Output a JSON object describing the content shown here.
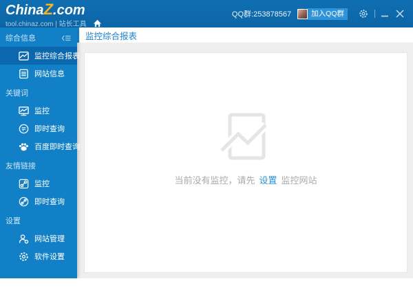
{
  "titlebar": {
    "logo": {
      "part1": "China",
      "part2": "Z",
      "part3": ".com"
    },
    "subtitle": "tool.chinaz.com | 站长工具",
    "qq_group_label": "QQ群:253878567",
    "join_qq_button": "加入QQ群",
    "icons": [
      "home-icon",
      "qq-group-avatar",
      "gear-icon",
      "minimize-icon",
      "close-icon"
    ]
  },
  "sidebar": {
    "collapse_icon": "collapse-menu-icon",
    "sections": [
      {
        "label": "综合信息",
        "items": [
          {
            "label": "监控综合报表",
            "icon": "chart-report-icon",
            "selected": true
          },
          {
            "label": "网站信息",
            "icon": "site-info-icon",
            "selected": false
          }
        ]
      },
      {
        "label": "关键词",
        "items": [
          {
            "label": "监控",
            "icon": "keyword-monitor-icon",
            "selected": false
          },
          {
            "label": "即时查询",
            "icon": "word-query-icon",
            "selected": false
          },
          {
            "label": "百度即时查询",
            "icon": "baidu-paw-icon",
            "selected": false
          }
        ]
      },
      {
        "label": "友情链接",
        "items": [
          {
            "label": "监控",
            "icon": "link-monitor-icon",
            "selected": false
          },
          {
            "label": "即时查询",
            "icon": "link-query-icon",
            "selected": false
          }
        ]
      },
      {
        "label": "设置",
        "items": [
          {
            "label": "网站管理",
            "icon": "site-manage-user-icon",
            "selected": false
          },
          {
            "label": "软件设置",
            "icon": "software-gear-icon",
            "selected": false
          }
        ]
      }
    ]
  },
  "main": {
    "page_title": "监控综合报表",
    "empty_state": {
      "icon": "empty-chart-icon",
      "text_before": "当前没有监控，请先",
      "link_label": "设置",
      "text_after": "监控网站"
    }
  },
  "colors": {
    "titlebar": "#0D68AC",
    "sidebar": "#1180C6",
    "sidebar_selected": "#0C68AE",
    "accent_blue": "#1E86D1",
    "link_blue": "#2E91D6",
    "logo_yellow": "#F9B61C",
    "body_gray": "#EFEFEF",
    "muted_text": "#ABABAB"
  }
}
